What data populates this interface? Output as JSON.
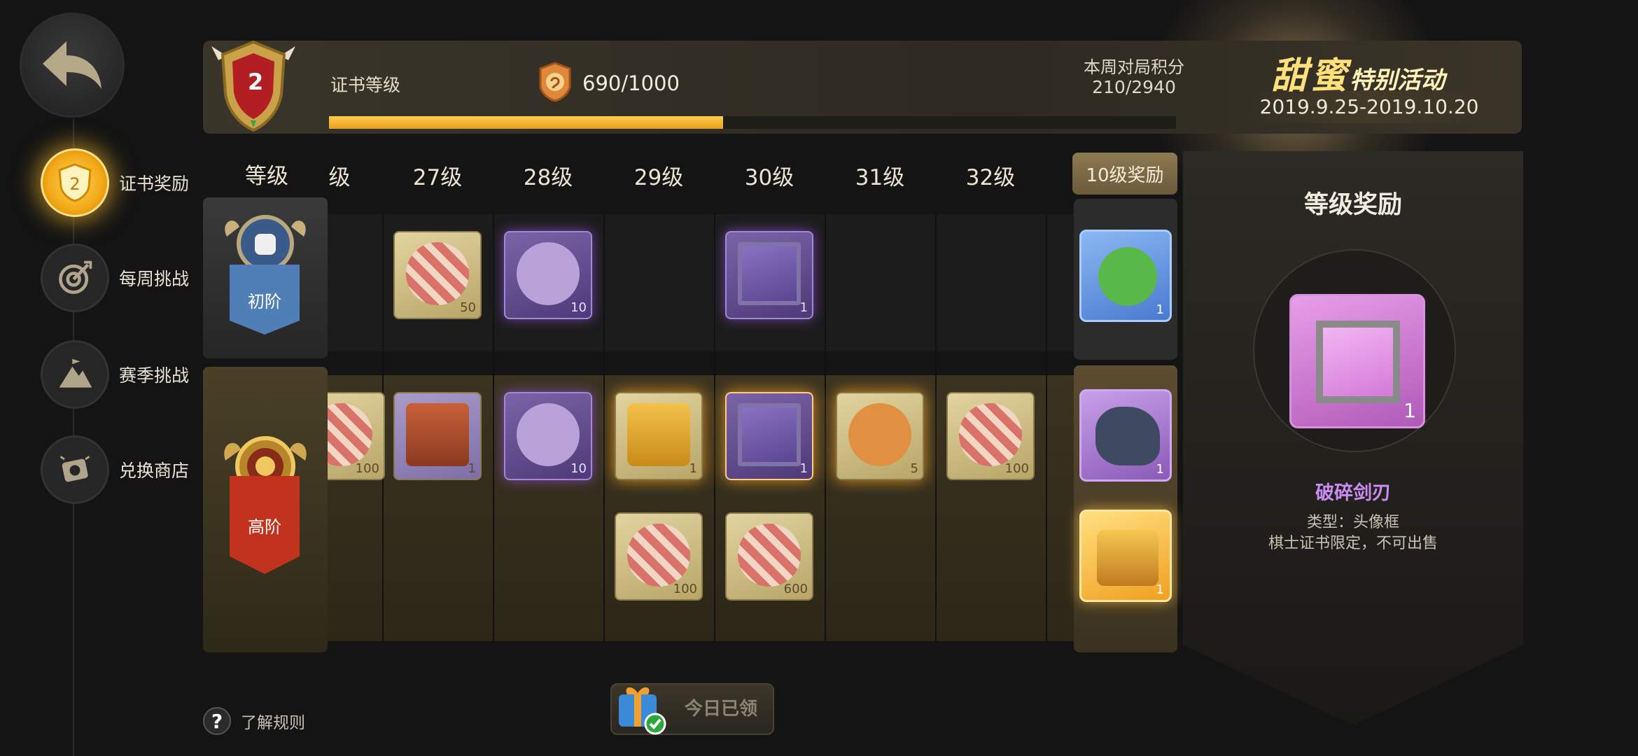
{
  "nav": {
    "items": [
      {
        "label": "证书奖励",
        "icon": "shield-badge-icon",
        "active": true
      },
      {
        "label": "每周挑战",
        "icon": "target-arrow-icon",
        "active": false
      },
      {
        "label": "赛季挑战",
        "icon": "mountain-flag-icon",
        "active": false
      },
      {
        "label": "兑换商店",
        "icon": "exchange-shop-icon",
        "active": false
      }
    ]
  },
  "header": {
    "rank_level": "2",
    "cert_label": "证书等级",
    "points": "690/1000",
    "progress": 0.465,
    "weekly_title": "本周对局积分",
    "weekly_value": "210/2940",
    "event_sweet": "甜蜜",
    "event_special": "特别活动",
    "event_date": "2019.9.25-2019.10.20"
  },
  "grid": {
    "level_label": "等级",
    "levels": [
      "级",
      "27级",
      "28级",
      "29级",
      "30级",
      "31级",
      "32级"
    ],
    "tier_free_label": "初阶",
    "tier_premium_label": "高阶",
    "bonus_header": "10级奖励",
    "free_items": [
      {
        "qty": "50",
        "style": "gold"
      },
      {
        "qty": "10",
        "style": "purple"
      },
      {
        "qty": "1",
        "style": "purple"
      }
    ],
    "premium_items": [
      {
        "qty": "100",
        "style": "gold"
      },
      {
        "qty": "1",
        "style": "gold"
      },
      {
        "qty": "10",
        "style": "purple"
      },
      {
        "qty": "1",
        "style": "gold"
      },
      {
        "qty": "1",
        "style": "purple"
      },
      {
        "qty": "5",
        "style": "gold"
      },
      {
        "qty": "100",
        "style": "gold"
      },
      {
        "qty": "100",
        "style": "gold"
      },
      {
        "qty": "600",
        "style": "gold"
      }
    ],
    "bonus_items": [
      {
        "qty": "1"
      },
      {
        "qty": "1"
      },
      {
        "qty": "1"
      }
    ]
  },
  "detail": {
    "title": "等级奖励",
    "qty": "1",
    "name": "破碎剑刃",
    "type": "类型：头像框",
    "desc": "棋士证书限定，不可出售"
  },
  "footer": {
    "rules_label": "了解规则",
    "daily_label": "今日已领"
  },
  "colors": {
    "accent_gold": "#f2a818",
    "progress_fill": "#e8a020",
    "purple_name": "#c98cf2"
  }
}
